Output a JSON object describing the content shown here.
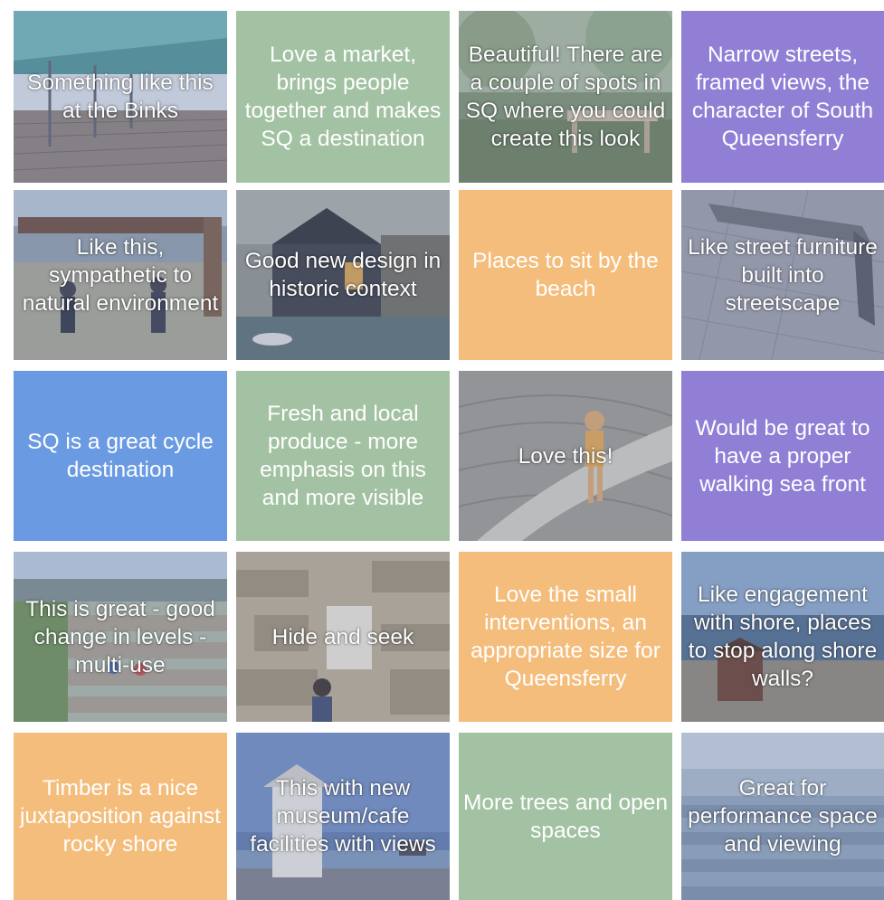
{
  "colors": {
    "green": "#a3c2a3",
    "orange": "#f4bd7c",
    "purple": "#917fd6",
    "blue": "#6a9ae2"
  },
  "tiles": [
    {
      "text": "Something like this at the Binks",
      "kind": "photo",
      "scene": "pier"
    },
    {
      "text": "Love a market, brings people together and makes SQ a destination",
      "kind": "green"
    },
    {
      "text": "Beautiful! There are a couple of spots in SQ where you could create this look",
      "kind": "photo",
      "scene": "garden-bench"
    },
    {
      "text": "Narrow streets, framed views, the character of South Queensferry",
      "kind": "purple"
    },
    {
      "text": "Like this, sympathetic to natural environment",
      "kind": "photo",
      "scene": "viewing-shelter"
    },
    {
      "text": "Good new design in historic context",
      "kind": "photo",
      "scene": "harbour-house"
    },
    {
      "text": "Places to sit by the beach",
      "kind": "orange"
    },
    {
      "text": "Like street furniture built into streetscape",
      "kind": "photo",
      "scene": "stone-bench"
    },
    {
      "text": "SQ is a great cycle destination",
      "kind": "blue"
    },
    {
      "text": "Fresh and local produce - more emphasis on this and more visible",
      "kind": "green"
    },
    {
      "text": "Love this!",
      "kind": "photo",
      "scene": "child-walkway"
    },
    {
      "text": "Would be great to have a proper walking sea front",
      "kind": "purple"
    },
    {
      "text": "This is great - good change in levels - multi-use",
      "kind": "photo",
      "scene": "timber-terraces"
    },
    {
      "text": "Hide and seek",
      "kind": "photo",
      "scene": "timber-cabin"
    },
    {
      "text": "Love the small interventions, an appropriate size for Queensferry",
      "kind": "orange"
    },
    {
      "text": "Like engagement with shore, places to stop along shore walls?",
      "kind": "photo",
      "scene": "shore-hut"
    },
    {
      "text": "Timber is a nice juxtaposition against rocky shore",
      "kind": "orange"
    },
    {
      "text": "This with new museum/cafe facilities with views",
      "kind": "photo",
      "scene": "seafront-kiosk"
    },
    {
      "text": "More trees and open spaces",
      "kind": "green"
    },
    {
      "text": "Great for performance space and viewing",
      "kind": "photo",
      "scene": "tidal-steps"
    }
  ]
}
